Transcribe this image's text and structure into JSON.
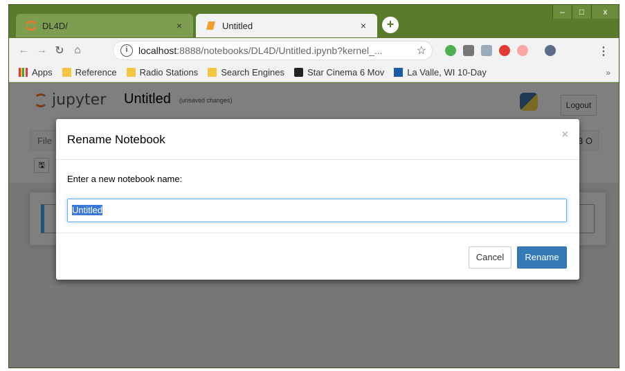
{
  "tabs": [
    {
      "title": "DL4D/",
      "close": "×"
    },
    {
      "title": "Untitled",
      "close": "×"
    }
  ],
  "new_tab": "+",
  "window_controls": {
    "minimize": "–",
    "maximize": "□",
    "close": "x"
  },
  "omnibox": {
    "info": "i",
    "host": "localhost",
    "path": ":8888/notebooks/DL4D/Untitled.ipynb?kernel_...",
    "star": "☆"
  },
  "menu": "⋮",
  "bookmarks": {
    "items": [
      "Apps",
      "Reference",
      "Radio Stations",
      "Search Engines",
      "Star Cinema 6 Mov",
      "La Valle, WI 10-Day"
    ],
    "more": "»"
  },
  "jupyter": {
    "logo_text": "jupyter",
    "notebook_name": "Untitled",
    "status": "(unsaved changes)",
    "logout": "Logout",
    "menu_file": "File",
    "kernel_indicator": "3 O",
    "save_icon": "🖫"
  },
  "modal": {
    "title": "Rename Notebook",
    "close": "×",
    "prompt": "Enter a new notebook name:",
    "input_value": "Untitled",
    "cancel": "Cancel",
    "rename": "Rename"
  },
  "colors": {
    "frame": "#5a7a2c",
    "primary_button": "#337ab7",
    "selection": "#3b78d8"
  }
}
